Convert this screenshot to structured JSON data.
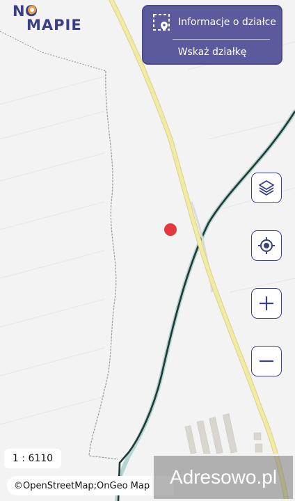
{
  "logo": {
    "line1": "NO",
    "line2": "MAPIE"
  },
  "info_panel": {
    "title": "Informacje o działce",
    "pick_button": "Wskaż działkę"
  },
  "controls": {
    "layers": "layers-icon",
    "locate": "crosshair-icon",
    "zoom_in": "plus-icon",
    "zoom_out": "minus-icon"
  },
  "scale": "1 : 6110",
  "attribution": "©OpenStreetMap;OnGeo Map",
  "watermark": "Adresowo.pl",
  "colors": {
    "brand": "#5a5a9c",
    "road": "#f2eba4",
    "rail": "#1f3b36",
    "marker": "#e3383d"
  }
}
